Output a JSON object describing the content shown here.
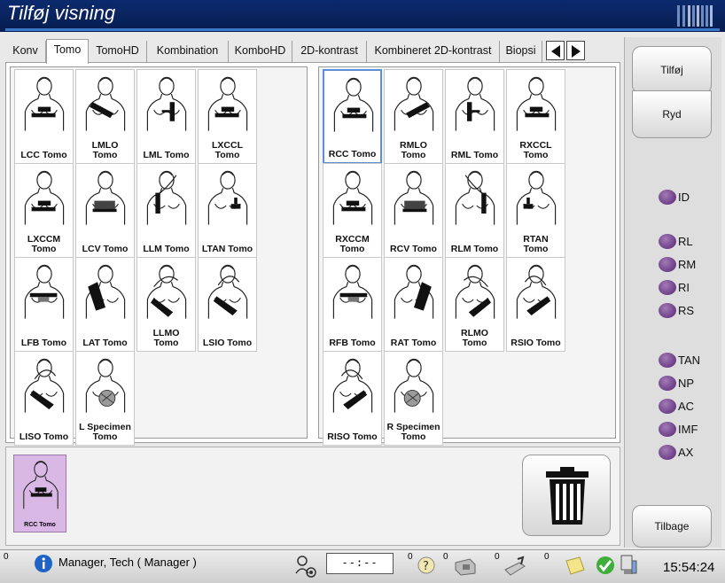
{
  "window": {
    "title": "Tilføj visning"
  },
  "tabs": [
    {
      "label": "Konv",
      "active": false
    },
    {
      "label": "Tomo",
      "active": true
    },
    {
      "label": "TomoHD",
      "active": false
    },
    {
      "label": "Kombination",
      "active": false
    },
    {
      "label": "KomboHD",
      "active": false
    },
    {
      "label": "2D-kontrast",
      "active": false
    },
    {
      "label": "Kombineret 2D-kontrast",
      "active": false
    },
    {
      "label": "Biopsi",
      "active": false
    }
  ],
  "nav": {
    "prev_icon": "triangle-left-icon",
    "next_icon": "triangle-right-icon"
  },
  "left_views": [
    {
      "label": "LCC Tomo",
      "pose": "cc",
      "side": "left"
    },
    {
      "label": "LMLO\nTomo",
      "pose": "mlo",
      "side": "left"
    },
    {
      "label": "LML Tomo",
      "pose": "ml",
      "side": "left"
    },
    {
      "label": "LXCCL\nTomo",
      "pose": "cc",
      "side": "left"
    },
    {
      "label": "LXCCM\nTomo",
      "pose": "cc",
      "side": "left"
    },
    {
      "label": "LCV Tomo",
      "pose": "cv",
      "side": "left"
    },
    {
      "label": "LLM Tomo",
      "pose": "lm",
      "side": "left"
    },
    {
      "label": "LTAN Tomo",
      "pose": "tan",
      "side": "left"
    },
    {
      "label": "LFB Tomo",
      "pose": "fb",
      "side": "left"
    },
    {
      "label": "LAT Tomo",
      "pose": "lat",
      "side": "left"
    },
    {
      "label": "LLMO\nTomo",
      "pose": "lmo",
      "side": "left"
    },
    {
      "label": "LSIO Tomo",
      "pose": "sio",
      "side": "left"
    },
    {
      "label": "LISO Tomo",
      "pose": "sio",
      "side": "left"
    },
    {
      "label": "L Specimen\nTomo",
      "pose": "specimen",
      "side": "left"
    }
  ],
  "right_views": [
    {
      "label": "RCC Tomo",
      "pose": "cc",
      "side": "right",
      "selected": true
    },
    {
      "label": "RMLO\nTomo",
      "pose": "mlo",
      "side": "right"
    },
    {
      "label": "RML Tomo",
      "pose": "ml",
      "side": "right"
    },
    {
      "label": "RXCCL\nTomo",
      "pose": "cc",
      "side": "right"
    },
    {
      "label": "RXCCM\nTomo",
      "pose": "cc",
      "side": "right"
    },
    {
      "label": "RCV Tomo",
      "pose": "cv",
      "side": "right"
    },
    {
      "label": "RLM Tomo",
      "pose": "lm",
      "side": "right"
    },
    {
      "label": "RTAN\nTomo",
      "pose": "tan",
      "side": "right"
    },
    {
      "label": "RFB Tomo",
      "pose": "fb",
      "side": "right"
    },
    {
      "label": "RAT Tomo",
      "pose": "lat",
      "side": "right"
    },
    {
      "label": "RLMO\nTomo",
      "pose": "lmo",
      "side": "right"
    },
    {
      "label": "RSIO Tomo",
      "pose": "sio",
      "side": "right"
    },
    {
      "label": "RISO Tomo",
      "pose": "sio",
      "side": "right"
    },
    {
      "label": "R Specimen\nTomo",
      "pose": "specimen",
      "side": "right"
    }
  ],
  "selected_views": [
    {
      "label": "RCC Tomo",
      "pose": "cc"
    }
  ],
  "actions": {
    "delete_icon": "trash-icon"
  },
  "sidebar": {
    "add_label": "Tilføj",
    "clear_label": "Ryd",
    "back_label": "Tilbage",
    "markers": [
      "ID",
      "RL",
      "RM",
      "RI",
      "RS",
      "TAN",
      "NP",
      "AC",
      "IMF",
      "AX"
    ]
  },
  "statusbar": {
    "info_count": "0",
    "user": "Manager, Tech ( Manager )",
    "timer": "--:--",
    "counts": [
      "0",
      "0",
      "0",
      "0"
    ],
    "clock": "15:54:24"
  },
  "colors": {
    "title_bg": "#0b2a6e",
    "marker": "#7b4a96",
    "selected_thumb": "#d9b8e6",
    "selected_border": "#5b8fd6"
  }
}
